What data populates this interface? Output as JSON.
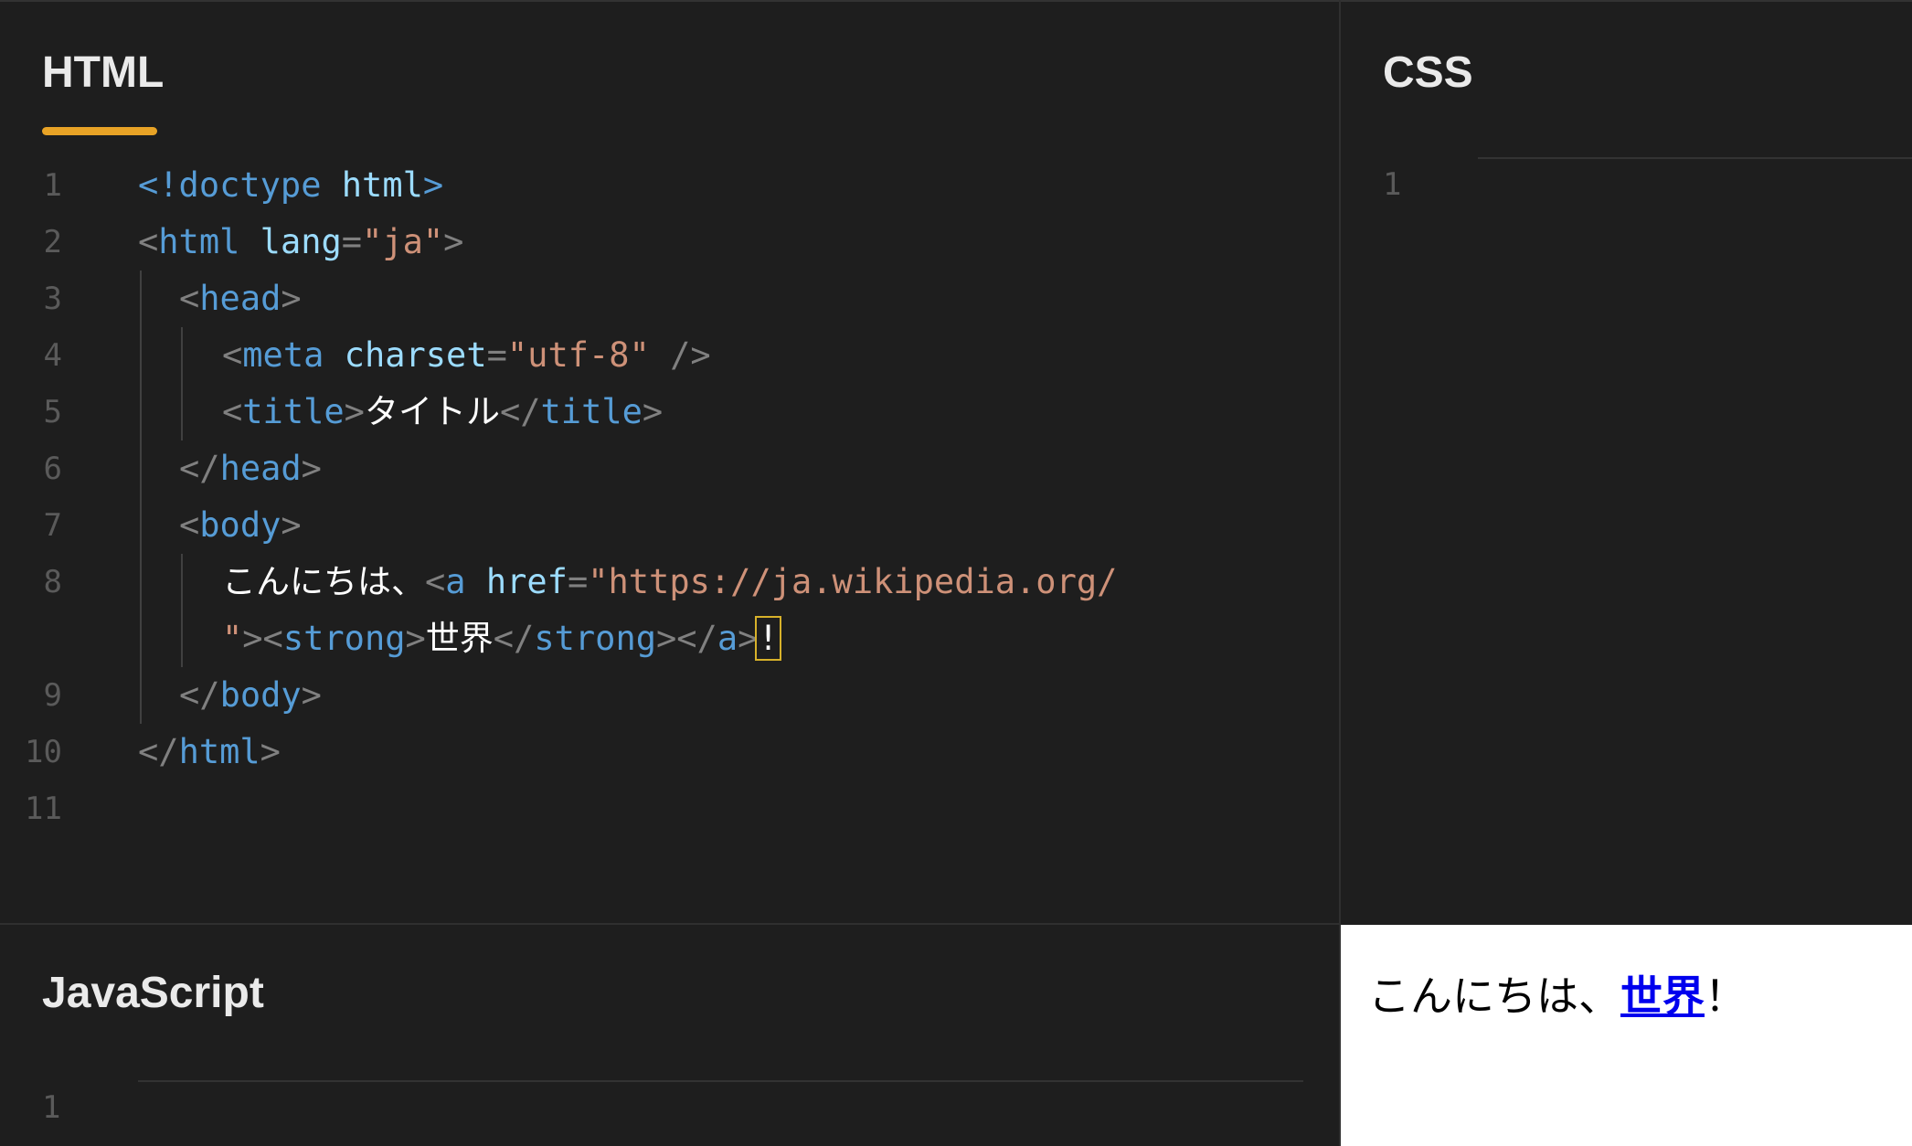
{
  "panes": {
    "html": {
      "title": "HTML",
      "lines": [
        {
          "num": "1",
          "indent": 0,
          "tokens": [
            {
              "t": "<!doctype",
              "c": "tag"
            },
            {
              "t": " ",
              "c": "text"
            },
            {
              "t": "html",
              "c": "attr"
            },
            {
              "t": ">",
              "c": "tag"
            }
          ]
        },
        {
          "num": "2",
          "indent": 0,
          "tokens": [
            {
              "t": "<",
              "c": "punc"
            },
            {
              "t": "html",
              "c": "tag"
            },
            {
              "t": " ",
              "c": "text"
            },
            {
              "t": "lang",
              "c": "attr"
            },
            {
              "t": "=",
              "c": "punc"
            },
            {
              "t": "\"ja\"",
              "c": "str"
            },
            {
              "t": ">",
              "c": "punc"
            }
          ]
        },
        {
          "num": "3",
          "indent": 1,
          "tokens": [
            {
              "t": "<",
              "c": "punc"
            },
            {
              "t": "head",
              "c": "tag"
            },
            {
              "t": ">",
              "c": "punc"
            }
          ]
        },
        {
          "num": "4",
          "indent": 2,
          "tokens": [
            {
              "t": "<",
              "c": "punc"
            },
            {
              "t": "meta",
              "c": "tag"
            },
            {
              "t": " ",
              "c": "text"
            },
            {
              "t": "charset",
              "c": "attr"
            },
            {
              "t": "=",
              "c": "punc"
            },
            {
              "t": "\"utf-8\"",
              "c": "str"
            },
            {
              "t": " />",
              "c": "punc"
            }
          ]
        },
        {
          "num": "5",
          "indent": 2,
          "tokens": [
            {
              "t": "<",
              "c": "punc"
            },
            {
              "t": "title",
              "c": "tag"
            },
            {
              "t": ">",
              "c": "punc"
            },
            {
              "t": "タイトル",
              "c": "text"
            },
            {
              "t": "</",
              "c": "punc"
            },
            {
              "t": "title",
              "c": "tag"
            },
            {
              "t": ">",
              "c": "punc"
            }
          ]
        },
        {
          "num": "6",
          "indent": 1,
          "tokens": [
            {
              "t": "</",
              "c": "punc"
            },
            {
              "t": "head",
              "c": "tag"
            },
            {
              "t": ">",
              "c": "punc"
            }
          ]
        },
        {
          "num": "7",
          "indent": 1,
          "tokens": [
            {
              "t": "<",
              "c": "punc"
            },
            {
              "t": "body",
              "c": "tag"
            },
            {
              "t": ">",
              "c": "punc"
            }
          ]
        },
        {
          "num": "8",
          "indent": 2,
          "wrap": true,
          "tokens": [
            {
              "t": "こんにちは、",
              "c": "text"
            },
            {
              "t": "<",
              "c": "punc"
            },
            {
              "t": "a",
              "c": "tag"
            },
            {
              "t": " ",
              "c": "text"
            },
            {
              "t": "href",
              "c": "attr"
            },
            {
              "t": "=",
              "c": "punc"
            },
            {
              "t": "\"https://ja.wikipedia.org/",
              "c": "str"
            },
            {
              "t": "\n",
              "c": "br"
            },
            {
              "t": "\"",
              "c": "str"
            },
            {
              "t": "><",
              "c": "punc"
            },
            {
              "t": "strong",
              "c": "tag"
            },
            {
              "t": ">",
              "c": "punc"
            },
            {
              "t": "世界",
              "c": "text"
            },
            {
              "t": "</",
              "c": "punc"
            },
            {
              "t": "strong",
              "c": "tag"
            },
            {
              "t": "></",
              "c": "punc"
            },
            {
              "t": "a",
              "c": "tag"
            },
            {
              "t": ">",
              "c": "punc"
            },
            {
              "t": "!",
              "c": "cursor"
            }
          ]
        },
        {
          "num": "9",
          "indent": 1,
          "tokens": [
            {
              "t": "</",
              "c": "punc"
            },
            {
              "t": "body",
              "c": "tag"
            },
            {
              "t": ">",
              "c": "punc"
            }
          ]
        },
        {
          "num": "10",
          "indent": 0,
          "tokens": [
            {
              "t": "</",
              "c": "punc"
            },
            {
              "t": "html",
              "c": "tag"
            },
            {
              "t": ">",
              "c": "punc"
            }
          ]
        },
        {
          "num": "11",
          "indent": 0,
          "tokens": []
        }
      ]
    },
    "css": {
      "title": "CSS",
      "line_num": "1"
    },
    "js": {
      "title": "JavaScript",
      "line_num": "1"
    },
    "preview": {
      "text_before": "こんにちは、",
      "link_text": "世界",
      "text_after": "！"
    }
  },
  "colors": {
    "accent": "#e8a326",
    "tag": "#569cd6",
    "attr": "#9cdcfe",
    "string": "#ce9178",
    "link": "#0000ee"
  }
}
